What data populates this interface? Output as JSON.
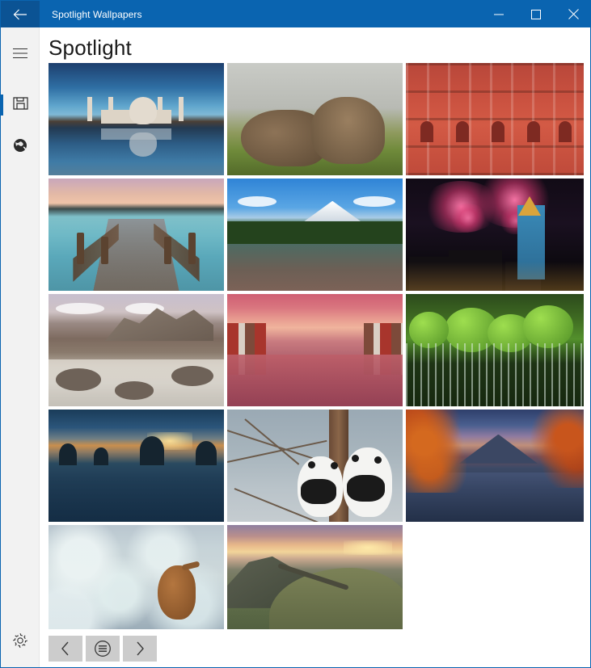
{
  "window": {
    "title": "Spotlight Wallpapers",
    "back_icon": "back-arrow-icon",
    "controls": {
      "minimize": "minimize-icon",
      "maximize": "maximize-icon",
      "close": "close-icon"
    },
    "accent_color": "#0a64b0",
    "titlebar_text_color": "#ffffff"
  },
  "sidebar": {
    "items": [
      {
        "name": "hamburger-menu",
        "icon": "hamburger-icon",
        "selected": false
      },
      {
        "name": "saved-wallpapers",
        "icon": "save-folder-icon",
        "selected": true
      },
      {
        "name": "online-wallpapers",
        "icon": "globe-icon",
        "selected": false
      }
    ],
    "bottom_items": [
      {
        "name": "settings",
        "icon": "gear-icon",
        "selected": false
      }
    ],
    "selection_color": "#0a64b0",
    "background": "#f2f2f2"
  },
  "main": {
    "page_title": "Spotlight",
    "gallery": {
      "columns": 3,
      "tiles": [
        {
          "id": 1,
          "art": "taj",
          "caption": "Taj Mahal reflected at dusk"
        },
        {
          "id": 2,
          "art": "marmot",
          "caption": "Two alpine marmots nuzzling"
        },
        {
          "id": 3,
          "art": "hawa",
          "caption": "Hawa Mahal pink facade, Jaipur"
        },
        {
          "id": 4,
          "art": "pier",
          "caption": "Wooden pier over calm lake at sunset"
        },
        {
          "id": 5,
          "art": "rainier",
          "caption": "Snowy peak reflected in forest lake"
        },
        {
          "id": 6,
          "art": "fire",
          "caption": "Fireworks over Edinburgh clock tower"
        },
        {
          "id": 7,
          "art": "stream",
          "caption": "Mountain stream below jagged peaks"
        },
        {
          "id": 8,
          "art": "trond",
          "caption": "Colourful riverside houses at dawn"
        },
        {
          "id": 9,
          "art": "moss",
          "caption": "Moss-covered rocks with waterfall"
        },
        {
          "id": 10,
          "art": "misty",
          "caption": "Misty lake island at sunrise"
        },
        {
          "id": 11,
          "art": "panda",
          "caption": "Two giant pandas in a tree"
        },
        {
          "id": 12,
          "art": "fuji",
          "caption": "Autumn leaves over lake and mountain"
        },
        {
          "id": 13,
          "art": "hare",
          "caption": "Hare hidden in frosted foliage"
        },
        {
          "id": 14,
          "art": "wall",
          "caption": "Stone wall along green ridge at sunrise"
        }
      ]
    }
  },
  "bottom_bar": {
    "buttons": [
      {
        "name": "previous-button",
        "icon": "chevron-left-icon"
      },
      {
        "name": "menu-button",
        "icon": "circled-menu-icon"
      },
      {
        "name": "next-button",
        "icon": "chevron-right-icon"
      }
    ],
    "button_background": "#cccccc"
  }
}
